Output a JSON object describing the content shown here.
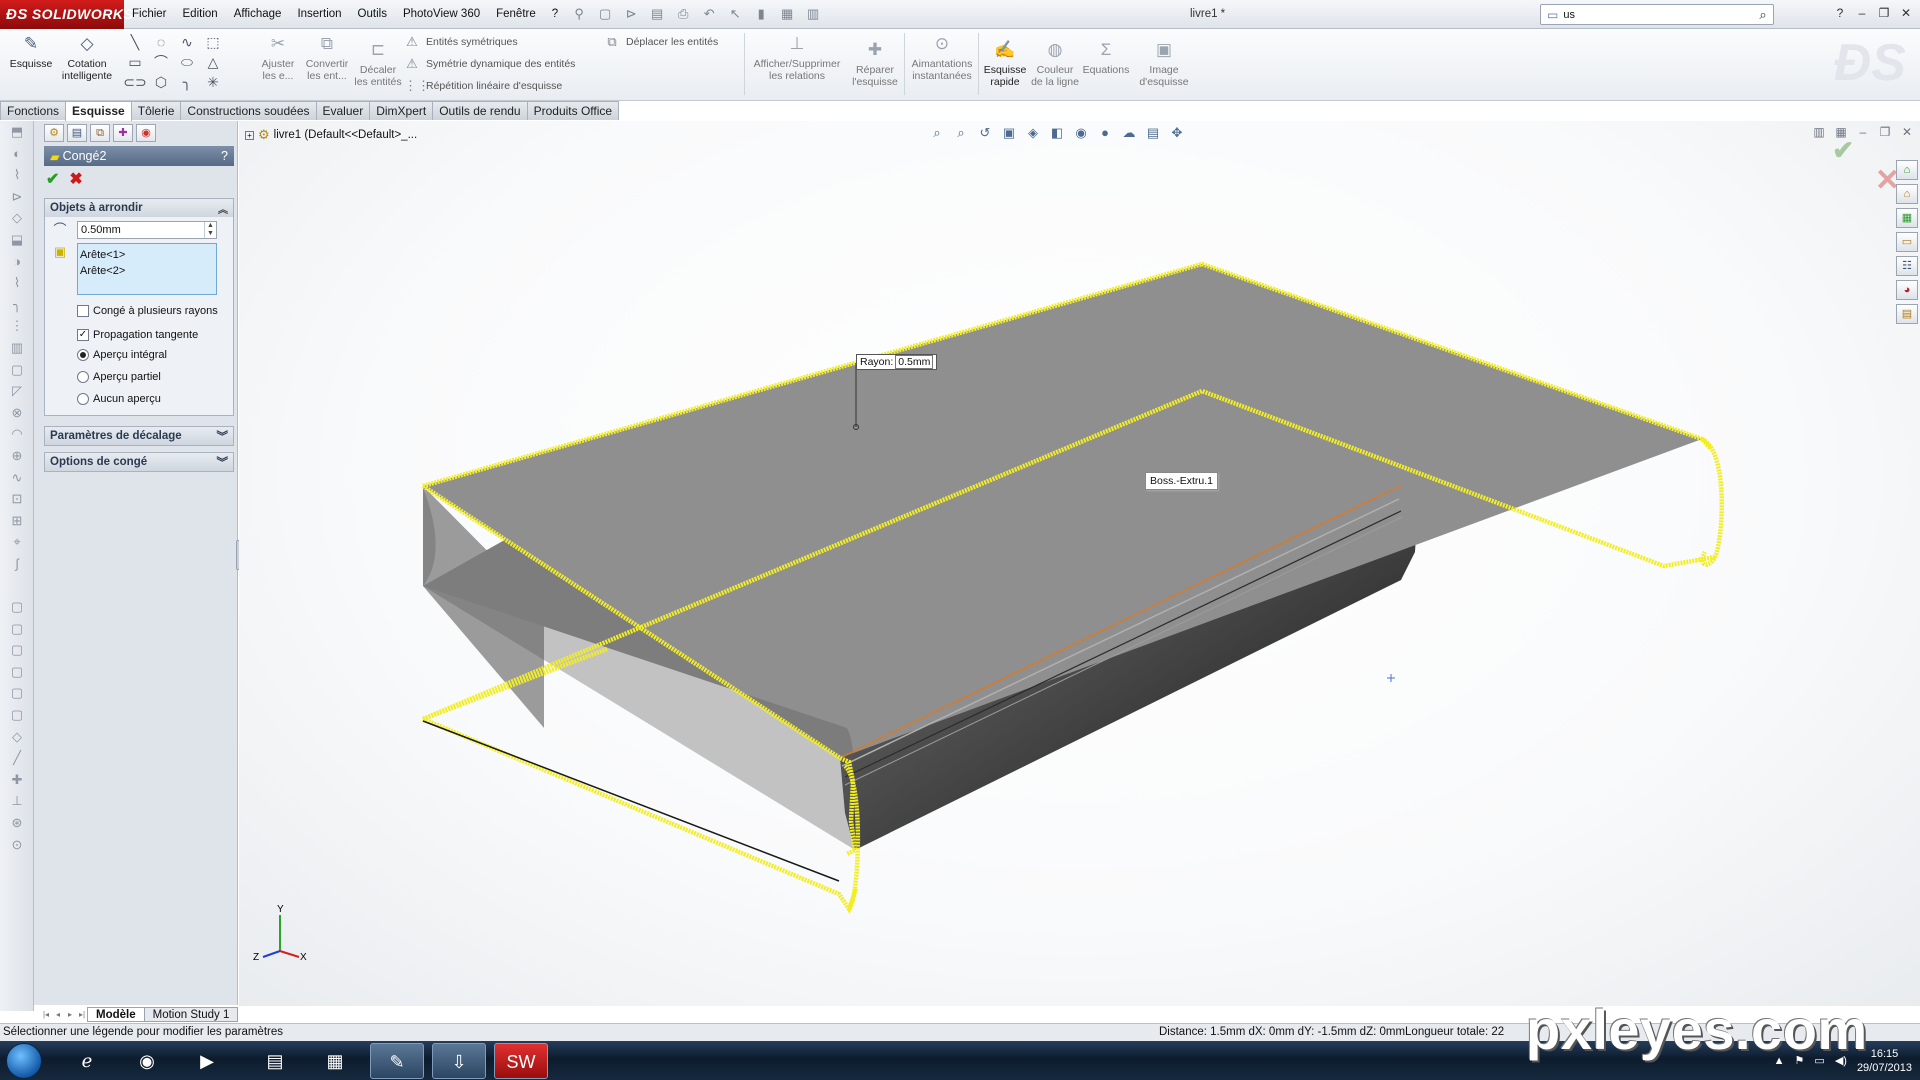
{
  "app": {
    "logo_text": "SOLIDWORKS",
    "doc_title": "livre1 *"
  },
  "menu": [
    "Fichier",
    "Edition",
    "Affichage",
    "Insertion",
    "Outils",
    "PhotoView 360",
    "Fenêtre",
    "?"
  ],
  "search": {
    "value": "us"
  },
  "command_manager": {
    "esquisse": "Esquisse",
    "cotation": "Cotation intelligente",
    "ajuster": "Ajuster les e...",
    "convertir": "Convertir les ent...",
    "decaler": "Décaler les entités",
    "entites_symetriques": "Entités symétriques",
    "symetrie_dynamique": "Symétrie dynamique des entités",
    "repetition_lineaire": "Répétition linéaire d'esquisse",
    "deplacer": "Déplacer les entités",
    "afficher_relations": "Afficher/Supprimer les relations",
    "reparer": "Réparer l'esquisse",
    "aimantations": "Aimantations instantanées",
    "esquisse_rapide": "Esquisse rapide",
    "couleur_ligne": "Couleur de la ligne",
    "equations": "Equations",
    "image_esquisse": "Image d'esquisse"
  },
  "tabs": [
    "Fonctions",
    "Esquisse",
    "Tôlerie",
    "Constructions soudées",
    "Evaluer",
    "DimXpert",
    "Outils de rendu",
    "Produits Office"
  ],
  "property_manager": {
    "title": "Congé2",
    "help": "?",
    "group_objects": "Objets à arrondir",
    "radius_value": "0.50mm",
    "selected_items": [
      "Arête<1>",
      "Arête<2>"
    ],
    "multi_radius": "Congé à plusieurs rayons",
    "tangent_propagation": "Propagation tangente",
    "preview_full": "Aperçu intégral",
    "preview_partial": "Aperçu partiel",
    "preview_none": "Aucun aperçu",
    "group_offset": "Paramètres de décalage",
    "group_options": "Options de congé"
  },
  "viewport": {
    "tree_root": "livre1  (Default<<Default>_...",
    "callout_label": "Rayon:",
    "callout_value": "0.5mm",
    "feature_tooltip": "Boss.-Extru.1",
    "triad_y": "Y",
    "triad_x": "X",
    "triad_z": "Z"
  },
  "bottom_tabs": [
    "Modèle",
    "Motion Study 1"
  ],
  "status": {
    "message": "Sélectionner une légende pour modifier les paramètres",
    "distance": "Distance: 1.5mm   dX: 0mm   dY: -1.5mm   dZ: 0mmLongueur totale: 22"
  },
  "taskbar": {
    "time": "16:15",
    "date": "29/07/2013"
  },
  "watermark": "pxleyes.com",
  "colors": {
    "selection_yellow": "#f2ee22",
    "model_top": "#8c8c8c",
    "accent_red": "#c8161d"
  }
}
